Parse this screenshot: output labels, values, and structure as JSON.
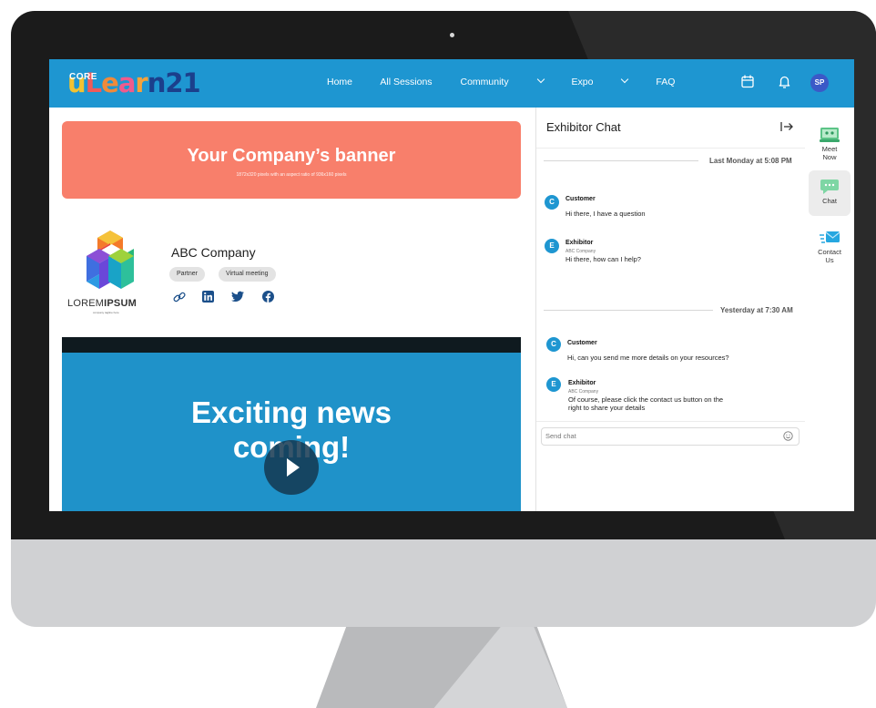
{
  "nav": {
    "logo_core": "CORE",
    "logo_text": "uLearn21",
    "links": [
      "Home",
      "All Sessions",
      "Community",
      "Expo",
      "FAQ"
    ],
    "avatar_initials": "SP"
  },
  "banner": {
    "title": "Your Company’s banner",
    "subtitle": "1872x320 pixels with an aspect ratio of 936x160 pixels"
  },
  "company": {
    "name": "ABC Company",
    "tags": [
      "Partner",
      "Virtual meeting"
    ],
    "logo_text_light": "LOREM",
    "logo_text_bold": "IPSUM",
    "logo_tagline": "company tagline here",
    "social_icons": [
      "link-icon",
      "linkedin-icon",
      "twitter-icon",
      "facebook-icon"
    ]
  },
  "video": {
    "headline_line1": "Exciting news",
    "headline_line2": "coming!"
  },
  "chat": {
    "title": "Exhibitor Chat",
    "stamp_1": "Last Monday at 5:08 PM",
    "stamp_2": "Yesterday at 7:30 AM",
    "messages": [
      {
        "initial": "C",
        "name": "Customer",
        "org": "",
        "text": "Hi there, I have a question"
      },
      {
        "initial": "E",
        "name": "Exhibitor",
        "org": "ABC Company",
        "text": "Hi there, how can I help?"
      },
      {
        "initial": "C",
        "name": "Customer",
        "org": "",
        "text": "Hi, can you send me more details on your resources?"
      },
      {
        "initial": "E",
        "name": "Exhibitor",
        "org": "ABC Company",
        "text_line1": "Of course, please click the contact us button on the",
        "text_line2": "right to share your details"
      }
    ],
    "input_placeholder": "Send chat"
  },
  "rail": {
    "meet_now_line1": "Meet",
    "meet_now_line2": "Now",
    "chat": "Chat",
    "contact_line1": "Contact",
    "contact_line2": "Us"
  },
  "colors": {
    "brand_blue": "#1e96d1",
    "banner_coral": "#f87f6b",
    "video_blue": "#1f92c9"
  }
}
